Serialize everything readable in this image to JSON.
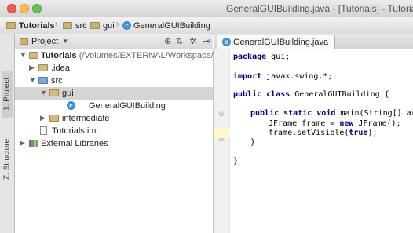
{
  "window": {
    "title": "GeneralGUIBuilding.java - [Tutorials] - Tutoria"
  },
  "navbar": {
    "crumbs": [
      "Tutorials",
      "src",
      "gui",
      "GeneralGUIBuilding"
    ],
    "separator": "›"
  },
  "sidebar_tabs": {
    "project": "1: Project",
    "structure": "Z: Structure"
  },
  "project_panel": {
    "view_label": "Project",
    "tree": [
      {
        "label": "Tutorials",
        "detail": "(/Volumes/EXTERNAL/Workspace/T",
        "expanded": true
      },
      {
        "label": ".idea",
        "expanded": false
      },
      {
        "label": "src",
        "expanded": true
      },
      {
        "label": "gui",
        "expanded": true,
        "selected": true
      },
      {
        "label": "GeneralGUIBuilding"
      },
      {
        "label": "intermediate",
        "expanded": false
      },
      {
        "label": "Tutorials.iml"
      },
      {
        "label": "External Libraries",
        "expanded": false
      }
    ]
  },
  "editor": {
    "tab_label": "GeneralGUIBuilding.java",
    "code": {
      "l1_kw": "package",
      "l1_rest": " gui;",
      "l2_kw": "import",
      "l2_rest": " javax.swing.*;",
      "l3_kw": "public class",
      "l3_rest": " GeneralGUIBuilding {",
      "l4_kw": "public static void",
      "l4_rest": " main(String[] arg",
      "l5_a": "JFrame frame = ",
      "l5_kw": "new",
      "l5_b": " JFrame();",
      "l6_a": "frame.setVisible(",
      "l6_kw": "true",
      "l6_b": ");",
      "l7": "}",
      "l8": "}"
    }
  },
  "colors": {
    "keyword": "#000080",
    "caret_line": "#fff9cc",
    "selection": "#d5d5d5"
  }
}
